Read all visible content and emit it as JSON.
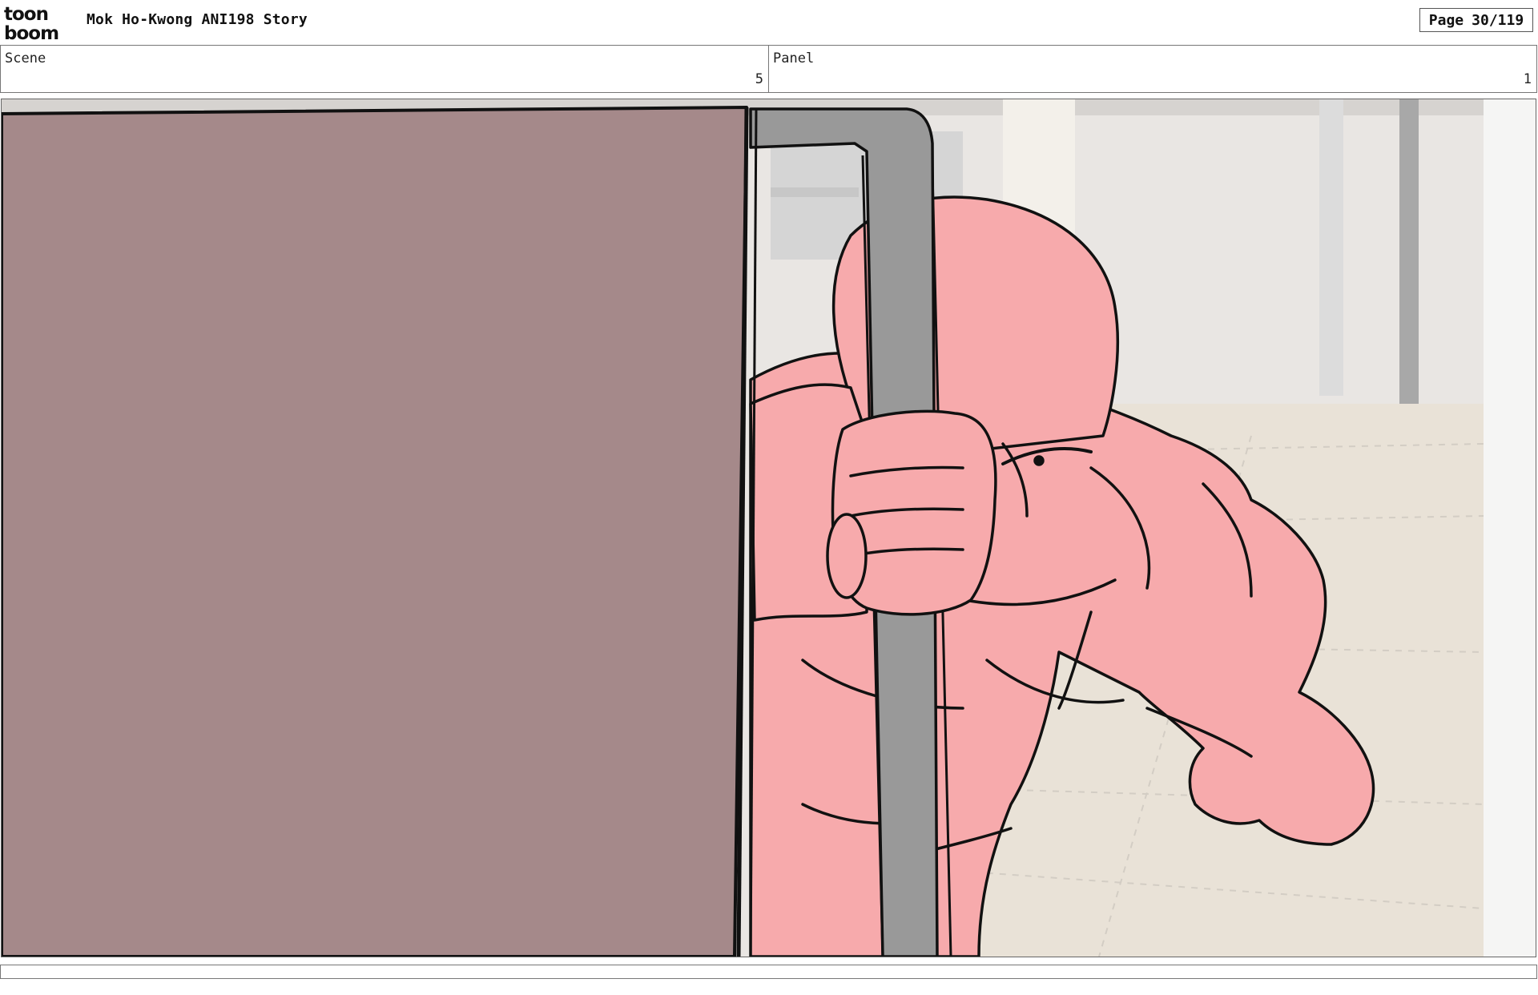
{
  "header": {
    "logo_line1": "toon",
    "logo_line2": "boom",
    "project_title": "Mok Ho-Kwong ANI198 Story",
    "page_label": "Page",
    "page_value": "30/119"
  },
  "info": {
    "scene_label": "Scene",
    "scene_value": "5",
    "panel_label": "Panel",
    "panel_value": "1"
  },
  "artwork": {
    "wall_color": "#a5898a",
    "character_color": "#f7aaac",
    "bar_color": "#999999",
    "floor_color": "#e9e2d7"
  }
}
